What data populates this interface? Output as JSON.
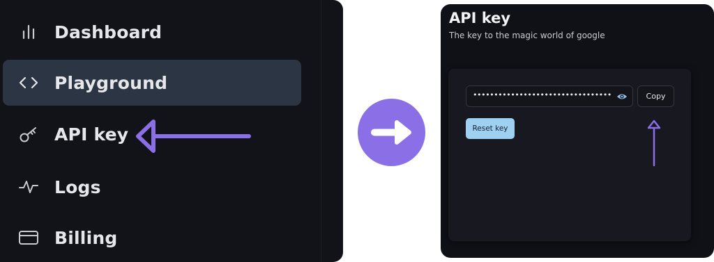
{
  "sidebar": {
    "items": [
      {
        "label": "Dashboard",
        "icon": "bar-chart-icon",
        "active": false
      },
      {
        "label": "Playground",
        "icon": "code-icon",
        "active": true
      },
      {
        "label": "API key",
        "icon": "key-icon",
        "active": false
      },
      {
        "label": "Logs",
        "icon": "activity-icon",
        "active": false
      },
      {
        "label": "Billing",
        "icon": "credit-card-icon",
        "active": false
      }
    ]
  },
  "colors": {
    "panel_bg": "#121319",
    "active_item_bg": "#2c3543",
    "accent_purple": "#8a6fe6",
    "reset_button_bg": "#9ed0f1"
  },
  "api_key_page": {
    "title": "API key",
    "subtitle": "The key to the magic world of google",
    "key_masked": "••••••••••••••••••••••••••••••••••••••••",
    "copy_label": "Copy",
    "reset_label": "Reset key"
  }
}
